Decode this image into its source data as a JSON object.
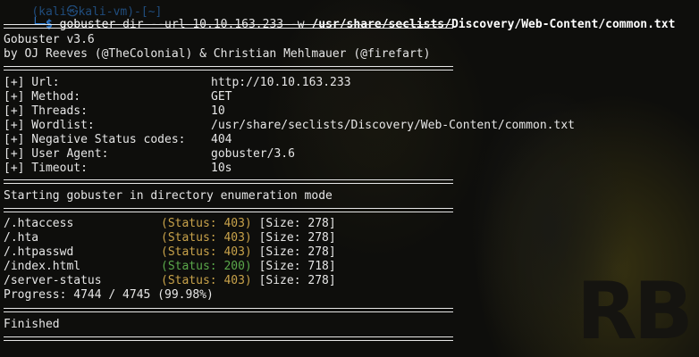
{
  "prompt": {
    "top_clipped": "(kali㉿kali-vm)-[~]",
    "arrow": "└─",
    "symbol": "$",
    "command": "gobuster",
    "subcommand": "dir",
    "url_flag": "--url",
    "url_value": "10.10.163.233",
    "wordlist_flag": "-w",
    "wordlist_path": "/usr/share/seclists/Discovery/Web-Content/common.txt"
  },
  "banner": {
    "version": "Gobuster v3.6",
    "authors": "by OJ Reeves (@TheColonial) & Christian Mehlmauer (@firefart)"
  },
  "config": [
    {
      "key": "[+] Url:",
      "value": "http://10.10.163.233"
    },
    {
      "key": "[+] Method:",
      "value": "GET"
    },
    {
      "key": "[+] Threads:",
      "value": "10"
    },
    {
      "key": "[+] Wordlist:",
      "value": "/usr/share/seclists/Discovery/Web-Content/common.txt"
    },
    {
      "key": "[+] Negative Status codes:",
      "value": "404"
    },
    {
      "key": "[+] User Agent:",
      "value": "gobuster/3.6"
    },
    {
      "key": "[+] Timeout:",
      "value": "10s"
    }
  ],
  "start_message": "Starting gobuster in directory enumeration mode",
  "results": [
    {
      "path": "/.htaccess",
      "status": "(Status: 403)",
      "size": "[Size: 278]"
    },
    {
      "path": "/.hta",
      "status": "(Status: 403)",
      "size": "[Size: 278]"
    },
    {
      "path": "/.htpasswd",
      "status": "(Status: 403)",
      "size": "[Size: 278]"
    },
    {
      "path": "/index.html",
      "status": "(Status: 200)",
      "size": "[Size: 718]"
    },
    {
      "path": "/server-status",
      "status": "(Status: 403)",
      "size": "[Size: 278]"
    }
  ],
  "progress": "Progress: 4744 / 4745 (99.98%)",
  "finished": "Finished",
  "colors": {
    "prompt": "#2f7fd8",
    "status_403": "#c8a24a",
    "status_200": "#5aa84a"
  }
}
